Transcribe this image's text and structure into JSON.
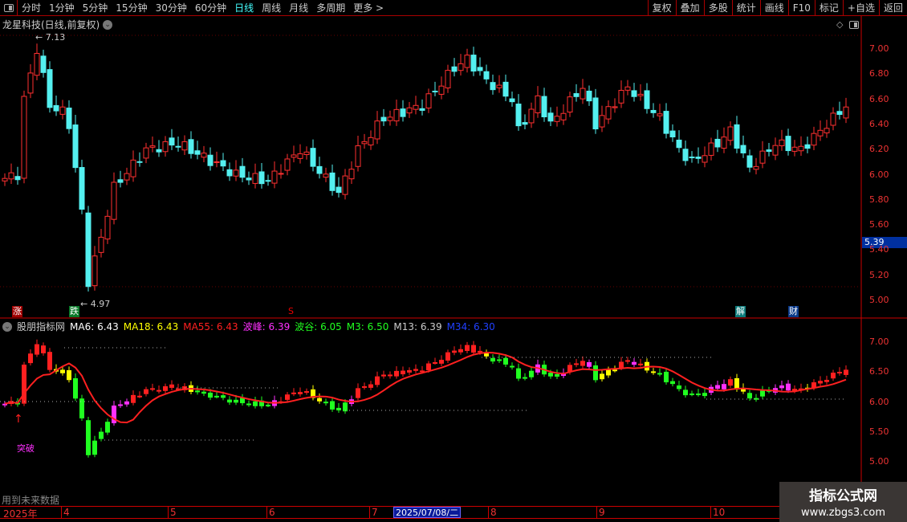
{
  "toolbar": {
    "periods": [
      "分时",
      "1分钟",
      "5分钟",
      "15分钟",
      "30分钟",
      "60分钟",
      "日线",
      "周线",
      "月线",
      "多周期",
      "更多 >"
    ],
    "active": "日线",
    "right_buttons": [
      "复权",
      "叠加",
      "多股",
      "统计",
      "画线",
      "F10",
      "标记",
      "+自选",
      "返回"
    ]
  },
  "title": "龙星科技(日线,前复权)",
  "annotations": {
    "high": "7.13",
    "low": "4.97",
    "current_price": "5.39",
    "breakout": "突破"
  },
  "markers": [
    {
      "label": "涨",
      "color": "#a00000"
    },
    {
      "label": "跌",
      "color": "#0a7a2a"
    },
    {
      "label": "S",
      "color": "#e00"
    },
    {
      "label": "解",
      "color": "#0a7a7a"
    },
    {
      "label": "财",
      "color": "#0a3a8a"
    }
  ],
  "indicator": {
    "name": "股朋指标网",
    "values": [
      {
        "label": "MA6: 6.43",
        "color": "#ffffff"
      },
      {
        "label": "MA18: 6.43",
        "color": "#ffff00"
      },
      {
        "label": "MA55: 6.43",
        "color": "#ff2020"
      },
      {
        "label": "波峰: 6.39",
        "color": "#ff30ff"
      },
      {
        "label": "波谷: 6.05",
        "color": "#20ff20"
      },
      {
        "label": "M3: 6.50",
        "color": "#20ff20"
      },
      {
        "label": "M13: 6.39",
        "color": "#cccccc"
      },
      {
        "label": "M34: 6.30",
        "color": "#2040ff"
      }
    ]
  },
  "main_axis": [
    "7.00",
    "6.80",
    "6.60",
    "6.40",
    "6.20",
    "6.00",
    "5.80",
    "5.60",
    "5.40",
    "5.20",
    "5.00"
  ],
  "sub_axis": [
    "7.00",
    "6.50",
    "6.00",
    "5.50",
    "5.00"
  ],
  "time_axis": {
    "months": [
      "2025年",
      "4",
      "5",
      "6",
      "7",
      "8",
      "9",
      "10"
    ],
    "selected_date": "2025/07/08/二"
  },
  "bottom_note": "用到未来数据",
  "watermark": {
    "title": "指标公式网",
    "url": "www.zbgs3.com"
  },
  "chart_data": {
    "type": "candlestick",
    "ylim_main": [
      4.9,
      7.1
    ],
    "ylim_sub": [
      4.9,
      7.3
    ],
    "keypoints": [
      [
        0,
        5.97
      ],
      [
        2,
        6.0
      ],
      [
        3,
        6.6
      ],
      [
        5,
        7.0
      ],
      [
        7,
        6.55
      ],
      [
        9,
        6.5
      ],
      [
        10,
        6.4
      ],
      [
        11,
        6.05
      ],
      [
        12,
        5.7
      ],
      [
        13,
        5.15
      ],
      [
        15,
        5.5
      ],
      [
        17,
        5.9
      ],
      [
        22,
        6.2
      ],
      [
        27,
        6.25
      ],
      [
        36,
        6.0
      ],
      [
        41,
        5.95
      ],
      [
        46,
        6.2
      ],
      [
        52,
        5.85
      ],
      [
        55,
        6.2
      ],
      [
        59,
        6.45
      ],
      [
        65,
        6.55
      ],
      [
        70,
        6.85
      ],
      [
        72,
        6.92
      ],
      [
        75,
        6.75
      ],
      [
        79,
        6.6
      ],
      [
        80,
        6.35
      ],
      [
        83,
        6.6
      ],
      [
        85,
        6.4
      ],
      [
        90,
        6.7
      ],
      [
        92,
        6.4
      ],
      [
        97,
        6.7
      ],
      [
        102,
        6.45
      ],
      [
        105,
        6.2
      ],
      [
        107,
        6.1
      ],
      [
        111,
        6.25
      ],
      [
        113,
        6.35
      ],
      [
        116,
        6.05
      ],
      [
        120,
        6.25
      ],
      [
        124,
        6.2
      ],
      [
        128,
        6.4
      ],
      [
        131,
        6.55
      ]
    ]
  }
}
